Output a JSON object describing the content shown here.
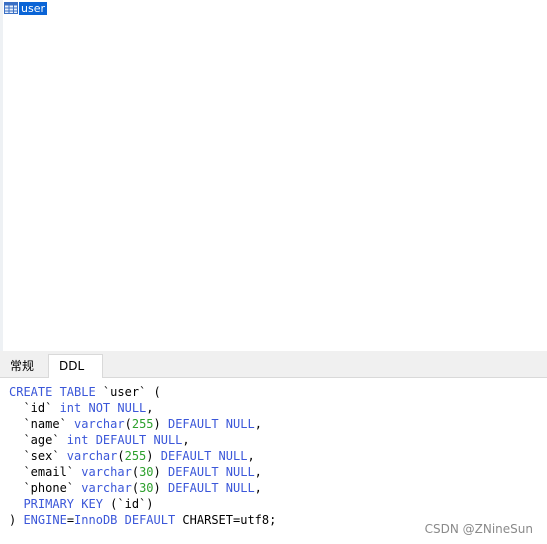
{
  "table_list": {
    "items": [
      {
        "name": "user",
        "icon": "table-grid-icon"
      }
    ]
  },
  "tabs": [
    {
      "label": "常规"
    },
    {
      "label": "DDL"
    }
  ],
  "ddl": {
    "lines": [
      [
        {
          "t": "CREATE TABLE",
          "c": "kw"
        },
        {
          "t": " `user` ("
        }
      ],
      [
        {
          "t": "  `id` "
        },
        {
          "t": "int NOT NULL",
          "c": "kw"
        },
        {
          "t": ","
        }
      ],
      [
        {
          "t": "  `name` "
        },
        {
          "t": "varchar",
          "c": "kw"
        },
        {
          "t": "("
        },
        {
          "t": "255",
          "c": "num"
        },
        {
          "t": ") "
        },
        {
          "t": "DEFAULT NULL",
          "c": "kw"
        },
        {
          "t": ","
        }
      ],
      [
        {
          "t": "  `age` "
        },
        {
          "t": "int DEFAULT NULL",
          "c": "kw"
        },
        {
          "t": ","
        }
      ],
      [
        {
          "t": "  `sex` "
        },
        {
          "t": "varchar",
          "c": "kw"
        },
        {
          "t": "("
        },
        {
          "t": "255",
          "c": "num"
        },
        {
          "t": ") "
        },
        {
          "t": "DEFAULT NULL",
          "c": "kw"
        },
        {
          "t": ","
        }
      ],
      [
        {
          "t": "  `email` "
        },
        {
          "t": "varchar",
          "c": "kw"
        },
        {
          "t": "("
        },
        {
          "t": "30",
          "c": "num"
        },
        {
          "t": ") "
        },
        {
          "t": "DEFAULT NULL",
          "c": "kw"
        },
        {
          "t": ","
        }
      ],
      [
        {
          "t": "  `phone` "
        },
        {
          "t": "varchar",
          "c": "kw"
        },
        {
          "t": "("
        },
        {
          "t": "30",
          "c": "num"
        },
        {
          "t": ") "
        },
        {
          "t": "DEFAULT NULL",
          "c": "kw"
        },
        {
          "t": ","
        }
      ],
      [
        {
          "t": "  "
        },
        {
          "t": "PRIMARY KEY",
          "c": "kw"
        },
        {
          "t": " (`id`)"
        }
      ],
      [
        {
          "t": ") "
        },
        {
          "t": "ENGINE",
          "c": "kw"
        },
        {
          "t": "="
        },
        {
          "t": "InnoDB DEFAULT",
          "c": "kw"
        },
        {
          "t": " CHARSET=utf8;"
        }
      ]
    ]
  },
  "watermark": "CSDN @ZNineSun",
  "colors": {
    "selection": "#0a64d6",
    "keyword": "#3b57d9",
    "number": "#2ca02c"
  }
}
